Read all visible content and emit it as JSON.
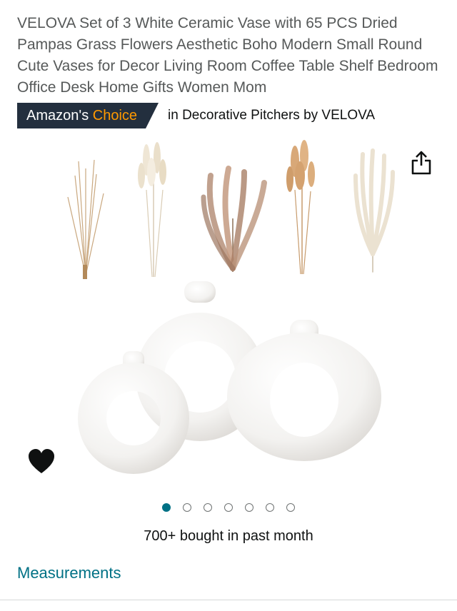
{
  "product": {
    "title": "VELOVA Set of 3 White Ceramic Vase with 65 PCS Dried Pampas Grass Flowers Aesthetic Boho Modern Small Round Cute Vases for Decor Living Room Coffee Table Shelf Bedroom Office Desk Home Gifts Women Mom"
  },
  "badge": {
    "prefix": "Amazon's",
    "highlight": "Choice",
    "category": "in Decorative Pitchers by VELOVA",
    "colors": {
      "background": "#232f3e",
      "highlight": "#ff9900"
    }
  },
  "gallery": {
    "dots": [
      {
        "active": true
      },
      {
        "active": false
      },
      {
        "active": false
      },
      {
        "active": false
      },
      {
        "active": false
      },
      {
        "active": false
      },
      {
        "active": false
      }
    ],
    "accent": "#007185"
  },
  "icons": {
    "share": "share-icon",
    "wishlist": "heart-icon"
  },
  "social_proof": {
    "text": "700+ bought in past month"
  },
  "sections": {
    "measurements": "Measurements"
  }
}
